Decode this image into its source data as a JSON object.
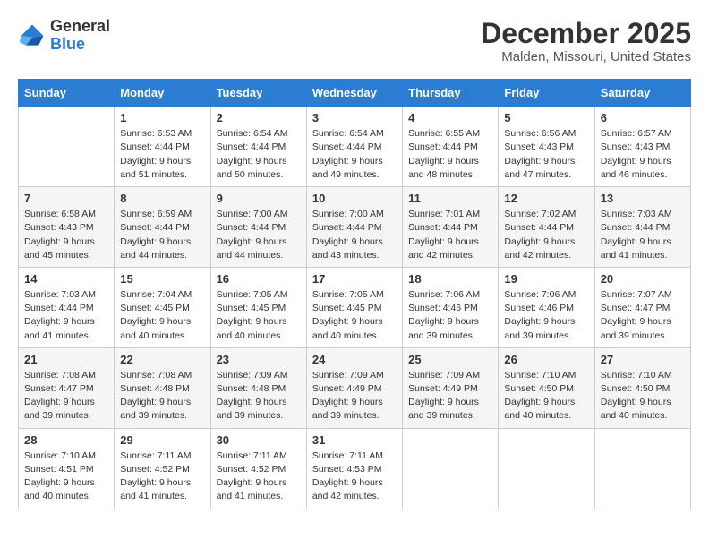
{
  "header": {
    "logo_general": "General",
    "logo_blue": "Blue",
    "title": "December 2025",
    "subtitle": "Malden, Missouri, United States"
  },
  "calendar": {
    "days_of_week": [
      "Sunday",
      "Monday",
      "Tuesday",
      "Wednesday",
      "Thursday",
      "Friday",
      "Saturday"
    ],
    "weeks": [
      [
        {
          "day": "",
          "sunrise": "",
          "sunset": "",
          "daylight": ""
        },
        {
          "day": "1",
          "sunrise": "Sunrise: 6:53 AM",
          "sunset": "Sunset: 4:44 PM",
          "daylight": "Daylight: 9 hours and 51 minutes."
        },
        {
          "day": "2",
          "sunrise": "Sunrise: 6:54 AM",
          "sunset": "Sunset: 4:44 PM",
          "daylight": "Daylight: 9 hours and 50 minutes."
        },
        {
          "day": "3",
          "sunrise": "Sunrise: 6:54 AM",
          "sunset": "Sunset: 4:44 PM",
          "daylight": "Daylight: 9 hours and 49 minutes."
        },
        {
          "day": "4",
          "sunrise": "Sunrise: 6:55 AM",
          "sunset": "Sunset: 4:44 PM",
          "daylight": "Daylight: 9 hours and 48 minutes."
        },
        {
          "day": "5",
          "sunrise": "Sunrise: 6:56 AM",
          "sunset": "Sunset: 4:43 PM",
          "daylight": "Daylight: 9 hours and 47 minutes."
        },
        {
          "day": "6",
          "sunrise": "Sunrise: 6:57 AM",
          "sunset": "Sunset: 4:43 PM",
          "daylight": "Daylight: 9 hours and 46 minutes."
        }
      ],
      [
        {
          "day": "7",
          "sunrise": "Sunrise: 6:58 AM",
          "sunset": "Sunset: 4:43 PM",
          "daylight": "Daylight: 9 hours and 45 minutes."
        },
        {
          "day": "8",
          "sunrise": "Sunrise: 6:59 AM",
          "sunset": "Sunset: 4:44 PM",
          "daylight": "Daylight: 9 hours and 44 minutes."
        },
        {
          "day": "9",
          "sunrise": "Sunrise: 7:00 AM",
          "sunset": "Sunset: 4:44 PM",
          "daylight": "Daylight: 9 hours and 44 minutes."
        },
        {
          "day": "10",
          "sunrise": "Sunrise: 7:00 AM",
          "sunset": "Sunset: 4:44 PM",
          "daylight": "Daylight: 9 hours and 43 minutes."
        },
        {
          "day": "11",
          "sunrise": "Sunrise: 7:01 AM",
          "sunset": "Sunset: 4:44 PM",
          "daylight": "Daylight: 9 hours and 42 minutes."
        },
        {
          "day": "12",
          "sunrise": "Sunrise: 7:02 AM",
          "sunset": "Sunset: 4:44 PM",
          "daylight": "Daylight: 9 hours and 42 minutes."
        },
        {
          "day": "13",
          "sunrise": "Sunrise: 7:03 AM",
          "sunset": "Sunset: 4:44 PM",
          "daylight": "Daylight: 9 hours and 41 minutes."
        }
      ],
      [
        {
          "day": "14",
          "sunrise": "Sunrise: 7:03 AM",
          "sunset": "Sunset: 4:44 PM",
          "daylight": "Daylight: 9 hours and 41 minutes."
        },
        {
          "day": "15",
          "sunrise": "Sunrise: 7:04 AM",
          "sunset": "Sunset: 4:45 PM",
          "daylight": "Daylight: 9 hours and 40 minutes."
        },
        {
          "day": "16",
          "sunrise": "Sunrise: 7:05 AM",
          "sunset": "Sunset: 4:45 PM",
          "daylight": "Daylight: 9 hours and 40 minutes."
        },
        {
          "day": "17",
          "sunrise": "Sunrise: 7:05 AM",
          "sunset": "Sunset: 4:45 PM",
          "daylight": "Daylight: 9 hours and 40 minutes."
        },
        {
          "day": "18",
          "sunrise": "Sunrise: 7:06 AM",
          "sunset": "Sunset: 4:46 PM",
          "daylight": "Daylight: 9 hours and 39 minutes."
        },
        {
          "day": "19",
          "sunrise": "Sunrise: 7:06 AM",
          "sunset": "Sunset: 4:46 PM",
          "daylight": "Daylight: 9 hours and 39 minutes."
        },
        {
          "day": "20",
          "sunrise": "Sunrise: 7:07 AM",
          "sunset": "Sunset: 4:47 PM",
          "daylight": "Daylight: 9 hours and 39 minutes."
        }
      ],
      [
        {
          "day": "21",
          "sunrise": "Sunrise: 7:08 AM",
          "sunset": "Sunset: 4:47 PM",
          "daylight": "Daylight: 9 hours and 39 minutes."
        },
        {
          "day": "22",
          "sunrise": "Sunrise: 7:08 AM",
          "sunset": "Sunset: 4:48 PM",
          "daylight": "Daylight: 9 hours and 39 minutes."
        },
        {
          "day": "23",
          "sunrise": "Sunrise: 7:09 AM",
          "sunset": "Sunset: 4:48 PM",
          "daylight": "Daylight: 9 hours and 39 minutes."
        },
        {
          "day": "24",
          "sunrise": "Sunrise: 7:09 AM",
          "sunset": "Sunset: 4:49 PM",
          "daylight": "Daylight: 9 hours and 39 minutes."
        },
        {
          "day": "25",
          "sunrise": "Sunrise: 7:09 AM",
          "sunset": "Sunset: 4:49 PM",
          "daylight": "Daylight: 9 hours and 39 minutes."
        },
        {
          "day": "26",
          "sunrise": "Sunrise: 7:10 AM",
          "sunset": "Sunset: 4:50 PM",
          "daylight": "Daylight: 9 hours and 40 minutes."
        },
        {
          "day": "27",
          "sunrise": "Sunrise: 7:10 AM",
          "sunset": "Sunset: 4:50 PM",
          "daylight": "Daylight: 9 hours and 40 minutes."
        }
      ],
      [
        {
          "day": "28",
          "sunrise": "Sunrise: 7:10 AM",
          "sunset": "Sunset: 4:51 PM",
          "daylight": "Daylight: 9 hours and 40 minutes."
        },
        {
          "day": "29",
          "sunrise": "Sunrise: 7:11 AM",
          "sunset": "Sunset: 4:52 PM",
          "daylight": "Daylight: 9 hours and 41 minutes."
        },
        {
          "day": "30",
          "sunrise": "Sunrise: 7:11 AM",
          "sunset": "Sunset: 4:52 PM",
          "daylight": "Daylight: 9 hours and 41 minutes."
        },
        {
          "day": "31",
          "sunrise": "Sunrise: 7:11 AM",
          "sunset": "Sunset: 4:53 PM",
          "daylight": "Daylight: 9 hours and 42 minutes."
        },
        {
          "day": "",
          "sunrise": "",
          "sunset": "",
          "daylight": ""
        },
        {
          "day": "",
          "sunrise": "",
          "sunset": "",
          "daylight": ""
        },
        {
          "day": "",
          "sunrise": "",
          "sunset": "",
          "daylight": ""
        }
      ]
    ]
  }
}
